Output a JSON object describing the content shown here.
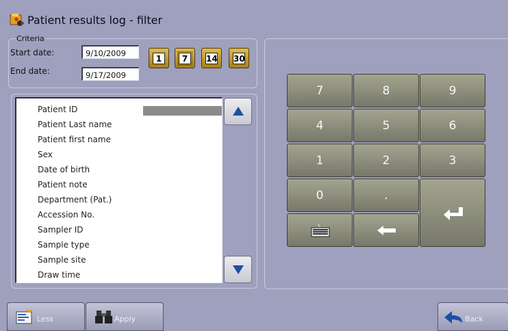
{
  "window": {
    "title": "Patient results log - filter"
  },
  "criteria": {
    "legend": "Criteria",
    "start_label": "Start date:",
    "start_value": "9/10/2009",
    "end_label": "End date:",
    "end_value": "9/17/2009",
    "range_buttons": [
      "1",
      "7",
      "14",
      "30"
    ],
    "selected_range": "7"
  },
  "fields": [
    "Patient ID",
    "Patient Last name",
    "Patient first name",
    "Sex",
    "Date of birth",
    "Patient note",
    "Department (Pat.)",
    "Accession No.",
    "Sampler ID",
    "Sample type",
    "Sample site",
    "Draw time"
  ],
  "keypad": {
    "keys": [
      "7",
      "8",
      "9",
      "4",
      "5",
      "6",
      "1",
      "2",
      "3",
      "0",
      "."
    ],
    "icons": [
      "keyboard-icon",
      "backspace-arrow-icon",
      "enter-icon"
    ]
  },
  "buttons": {
    "less": "Less",
    "apply": "Apply",
    "back": "Back"
  },
  "colors": {
    "background": "#9ea0bd",
    "key": "#8c8d7c",
    "range_button": "#c9a43a",
    "scroll_arrow": "#1f4fa0"
  }
}
